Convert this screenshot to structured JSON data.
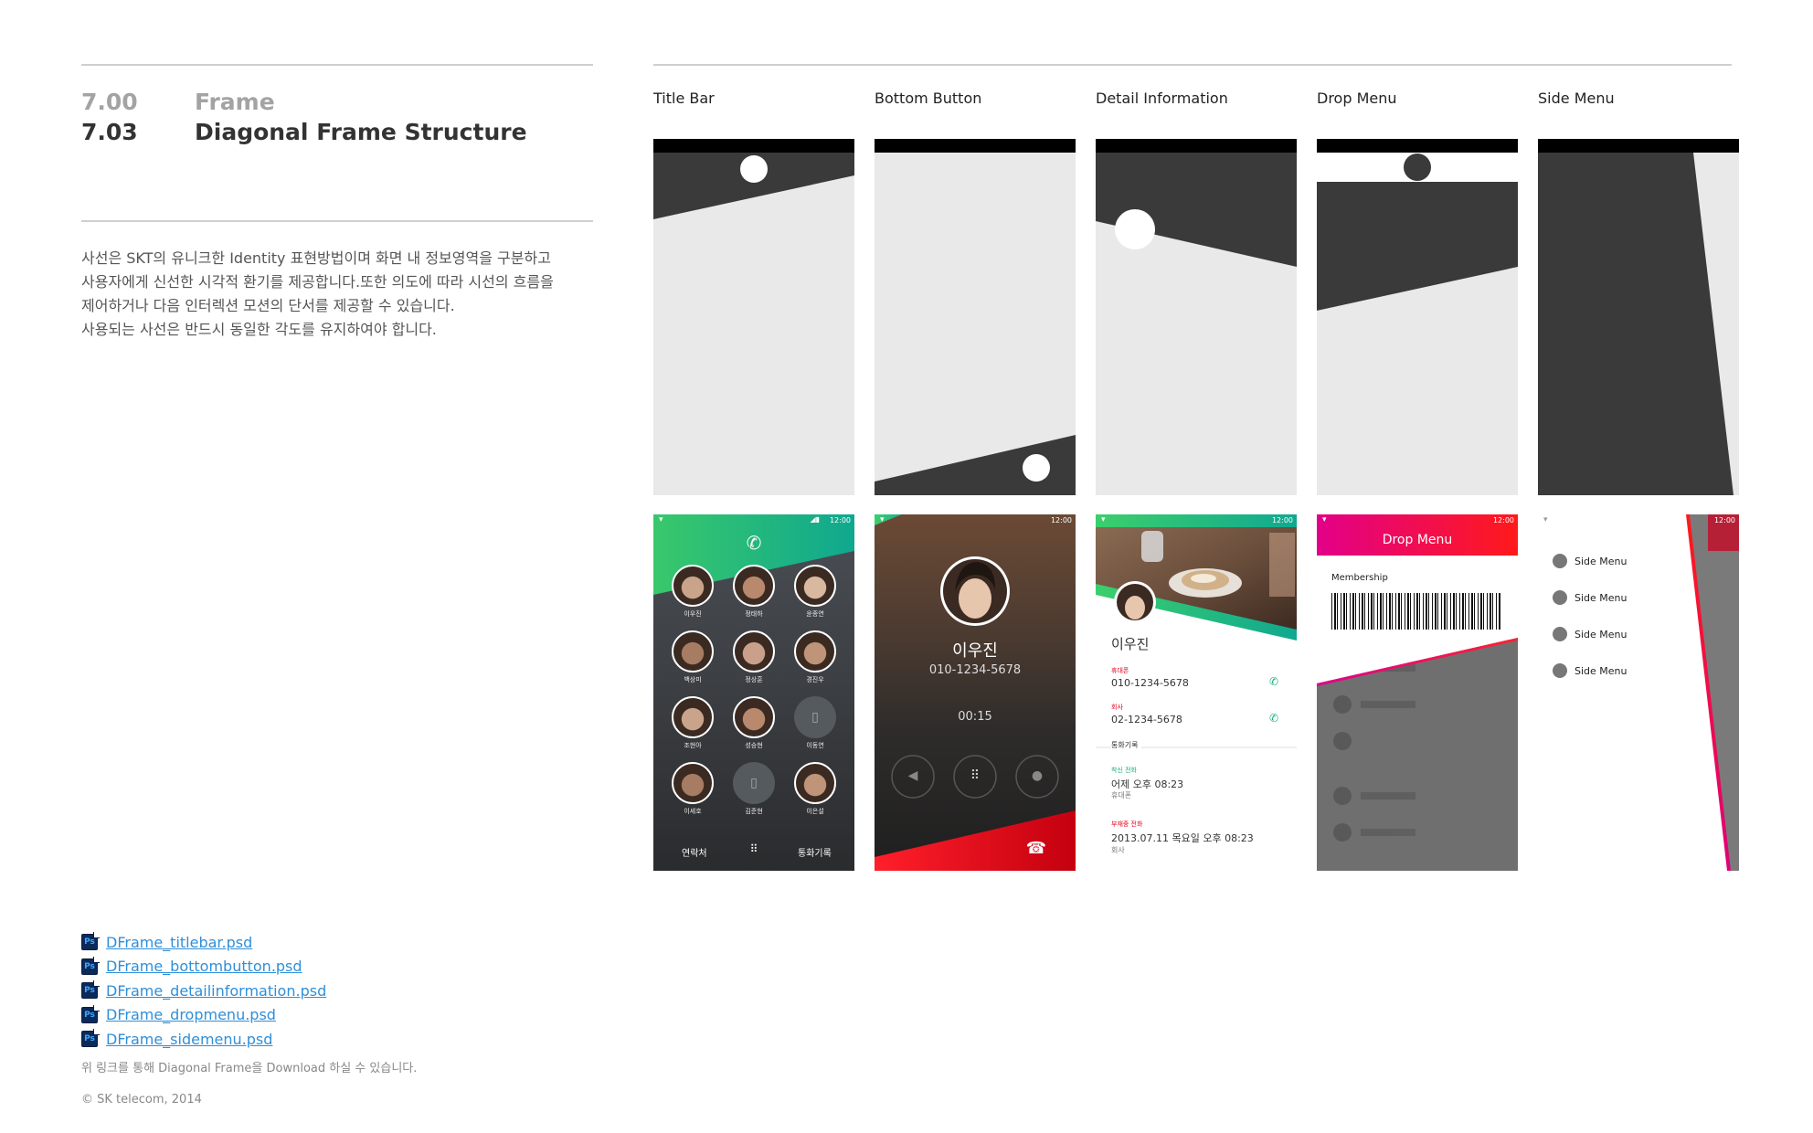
{
  "section": {
    "parent_number": "7.00",
    "parent_title": "Frame",
    "number": "7.03",
    "title": "Diagonal Frame Structure"
  },
  "description": [
    "사선은 SKT의 유니크한 Identity 표현방법이며 화면 내 정보영역을 구분하고",
    "사용자에게 신선한 시각적 환기를 제공합니다.또한 의도에 따라 시선의 흐름을",
    "제어하거나 다음 인터렉션 모션의 단서를 제공할 수 있습니다.",
    "사용되는 사선은 반드시 동일한 각도를 유지하여야 합니다."
  ],
  "columns": [
    {
      "label": "Title Bar"
    },
    {
      "label": "Bottom Button"
    },
    {
      "label": "Detail Information"
    },
    {
      "label": "Drop Menu"
    },
    {
      "label": "Side Menu"
    }
  ],
  "status_time": "12:00",
  "title_bar_screen": {
    "contacts": [
      [
        "이우진",
        "정태하",
        "윤종연"
      ],
      [
        "백상미",
        "정상훈",
        "경진우"
      ],
      [
        "조현아",
        "성승현",
        "이동연"
      ],
      [
        "이세호",
        "김준현",
        "이은설"
      ]
    ],
    "bottom_left": "연락처",
    "bottom_right": "통화기록"
  },
  "bottom_button_screen": {
    "name": "이우진",
    "number": "010-1234-5678",
    "timer": "00:15"
  },
  "detail_screen": {
    "name": "이우진",
    "rows": [
      {
        "tag": "휴대폰",
        "value": "010-1234-5678"
      },
      {
        "tag": "회사",
        "value": "02-1234-5678"
      }
    ],
    "history_header": "통화기록",
    "history": [
      {
        "tag": "착신 전화",
        "value": "어제 오후 08:23",
        "sub": "휴대폰"
      },
      {
        "tag": "부재중 전화",
        "value": "2013.07.11 목요일 오후 08:23",
        "sub": "회사"
      }
    ]
  },
  "drop_screen": {
    "title": "Drop Menu",
    "membership": "Membership"
  },
  "side_screen": {
    "items": [
      "Side Menu",
      "Side Menu",
      "Side Menu",
      "Side Menu"
    ]
  },
  "links": [
    "DFrame_titlebar.psd",
    "DFrame_bottombutton.psd",
    "DFrame_detailinformation.psd",
    "DFrame_dropmenu.psd",
    "DFrame_sidemenu.psd"
  ],
  "ps_icon_label": "Ps",
  "note": "위 링크를 통해 Diagonal Frame을 Download 하실 수 있습니다.",
  "copyright": "© SK telecom, 2014",
  "colors": {
    "dark": "#3a3a3a",
    "light_gray": "#e9e9e9",
    "green": "#16b27a",
    "red": "#e3001b",
    "magenta": "#e2007a",
    "link": "#2f8fd9"
  }
}
